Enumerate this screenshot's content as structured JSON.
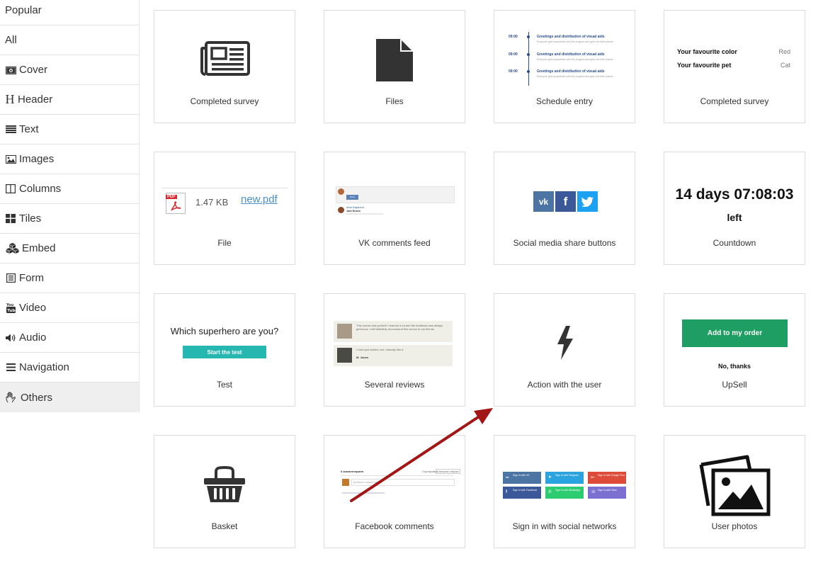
{
  "sidebar": {
    "items": [
      {
        "label": "Popular",
        "icon": "none"
      },
      {
        "label": "All",
        "icon": "none"
      },
      {
        "label": "Cover",
        "icon": "camera-icon"
      },
      {
        "label": "Header",
        "icon": "header-icon"
      },
      {
        "label": "Text",
        "icon": "text-lines-icon"
      },
      {
        "label": "Images",
        "icon": "image-icon"
      },
      {
        "label": "Columns",
        "icon": "columns-icon"
      },
      {
        "label": "Tiles",
        "icon": "tiles-icon"
      },
      {
        "label": "Embed",
        "icon": "cubes-icon"
      },
      {
        "label": "Form",
        "icon": "form-icon"
      },
      {
        "label": "Video",
        "icon": "youtube-icon"
      },
      {
        "label": "Audio",
        "icon": "speaker-icon"
      },
      {
        "label": "Navigation",
        "icon": "menu-icon"
      },
      {
        "label": "Others",
        "icon": "hand-icon"
      }
    ],
    "active": "Others"
  },
  "cards": [
    {
      "label": "Completed survey"
    },
    {
      "label": "Files"
    },
    {
      "label": "Schedule entry"
    },
    {
      "label": "Completed survey"
    },
    {
      "label": "File"
    },
    {
      "label": "VK comments feed"
    },
    {
      "label": "Social media share buttons"
    },
    {
      "label": "Countdown"
    },
    {
      "label": "Test"
    },
    {
      "label": "Several reviews"
    },
    {
      "label": "Action with the user"
    },
    {
      "label": "UpSell"
    },
    {
      "label": "Basket"
    },
    {
      "label": "Facebook comments"
    },
    {
      "label": "Sign in with social networks"
    },
    {
      "label": "User photos"
    }
  ],
  "schedule": {
    "entries": [
      {
        "time": "09:00",
        "title": "Greetings and distribution of visual aids",
        "sub": "Everyone gets acquainted with the program and gets into their places"
      },
      {
        "time": "09:00",
        "title": "Greetings and distribution of visual aids",
        "sub": "Everyone gets acquainted with the program and gets into their places"
      },
      {
        "time": "09:00",
        "title": "Greetings and distribution of visual aids",
        "sub": "Everyone gets acquainted with the program and gets into their places"
      }
    ]
  },
  "survey": {
    "rows": [
      {
        "key": "Your favourite color",
        "value": "Red"
      },
      {
        "key": "Your favourite pet",
        "value": "Cat"
      }
    ]
  },
  "file": {
    "size": "1.47 KB",
    "name": "new.pdf",
    "badge": "PDF"
  },
  "countdown": {
    "time": "14 days 07:08:03",
    "suffix": "left"
  },
  "test": {
    "question": "Which superhero are you?",
    "button": "Start the test"
  },
  "reviews": [
    {
      "text": "This course was perfect! I learned a lot and the feedback was always generous. I will definitely recommend this school to my friends.",
      "name": ""
    },
    {
      "text": "I have just started, but I already like it.",
      "name": "M. Jones"
    }
  ],
  "upsell": {
    "button": "Add to my order",
    "decline": "No, thanks"
  },
  "social_share": [
    {
      "name": "vk",
      "color": "#4c75a3",
      "glyph": "vk"
    },
    {
      "name": "facebook",
      "color": "#3b5998",
      "glyph": "f"
    },
    {
      "name": "twitter",
      "color": "#1da1f2",
      "glyph": "t"
    }
  ],
  "social_signin": [
    {
      "label": "Sign in with VK",
      "color": "#4c75a3",
      "glyph": "vk"
    },
    {
      "label": "Sign in with Telegram",
      "color": "#2aa3df",
      "glyph": "➤"
    },
    {
      "label": "Sign in with Google Plus",
      "color": "#dd4b39",
      "glyph": "G+"
    },
    {
      "label": "Sign in with Facebook",
      "color": "#3b5998",
      "glyph": "f"
    },
    {
      "label": "Sign in with WhatsApp",
      "color": "#2ecc71",
      "glyph": "✆"
    },
    {
      "label": "Sign in with Viber",
      "color": "#7b6fcf",
      "glyph": "☏"
    }
  ],
  "vk_feed": {
    "author": "Anna Kaganova",
    "author2": "Jane Brown",
    "button": "Send"
  },
  "fb_comments": {
    "count": "0 комментариев",
    "sort_label": "Сортировка",
    "sort_value": "Сначала старые",
    "placeholder": "Добавьте комментарий..."
  },
  "colors": {
    "accent_arrow": "#a31616",
    "active_bg": "#efefef",
    "border": "#dcdcdc"
  }
}
